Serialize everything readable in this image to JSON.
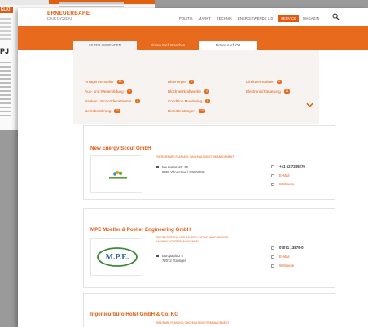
{
  "background_page": {
    "badge": "ELKI",
    "bold_text": "PJ"
  },
  "header": {
    "logo_line1": "ERNEUERBARE",
    "logo_line2": "ENERGIEN",
    "nav": [
      "POLITIK",
      "MARKT",
      "TECHNIK",
      "ENERGIEWENDE 2.0",
      "SERVICE",
      "MAGAZIN"
    ],
    "active_nav": "SERVICE"
  },
  "tabs": {
    "filter": "FILTER ANWENDEN",
    "branch": "Firmen nach Branchen",
    "location": "Firmen nach Ort"
  },
  "filters": {
    "col1": [
      {
        "label": "Anlagenhersteller",
        "count": "25"
      },
      {
        "label": "Aus- und Weiterbildung",
        "count": "9"
      },
      {
        "label": "Banken / Finanzdienstleister",
        "count": "3"
      },
      {
        "label": "Betriebsführung",
        "count": "10"
      }
    ],
    "col2": [
      {
        "label": "Bioenergie",
        "count": "9"
      },
      {
        "label": "Blockheizkraftwerke",
        "count": "4"
      },
      {
        "label": "Condition Monitoring",
        "count": "8"
      },
      {
        "label": "Dienstleistungen",
        "count": "18"
      }
    ],
    "col3": [
      {
        "label": "Direktvermarkter",
        "count": "6"
      },
      {
        "label": "Elektronik/Steuerung",
        "count": "11"
      }
    ]
  },
  "cards": [
    {
      "title": "New Energy Scout GmbH",
      "category": "ENERGIEPARK PLANUNG, NACHHALTIGKEITSMANAGEMENT",
      "street": "Neuwiesenstr. 95",
      "city": "8400 Winterthur / SCHWEIZ",
      "phone": "+41 52 7289270",
      "email": "E-Mail",
      "website": "Webseite",
      "logo_text": "new energy scout"
    },
    {
      "title": "MPE Moeller & Poeller Engineering GmbH",
      "category": "PROJEKTIERUNG UND BAUBEGLEITUNG WINDENERGIE, NACHHALTIGKEITSMANAGEMENT",
      "street": "Europaplatz 5",
      "city": "72072 Tübingen",
      "phone": "07071 13879-0",
      "email": "E-Mail",
      "website": "Webseite",
      "logo_text": "M.P.E."
    },
    {
      "title": "Ingenieurbüro Holst GmbH & Co. KG",
      "category": "WINDPARK PLANUNG, NACHHALTIGKEITSMANAGEMENT"
    }
  ],
  "colors": {
    "accent": "#e86a1c",
    "text": "#444444"
  }
}
